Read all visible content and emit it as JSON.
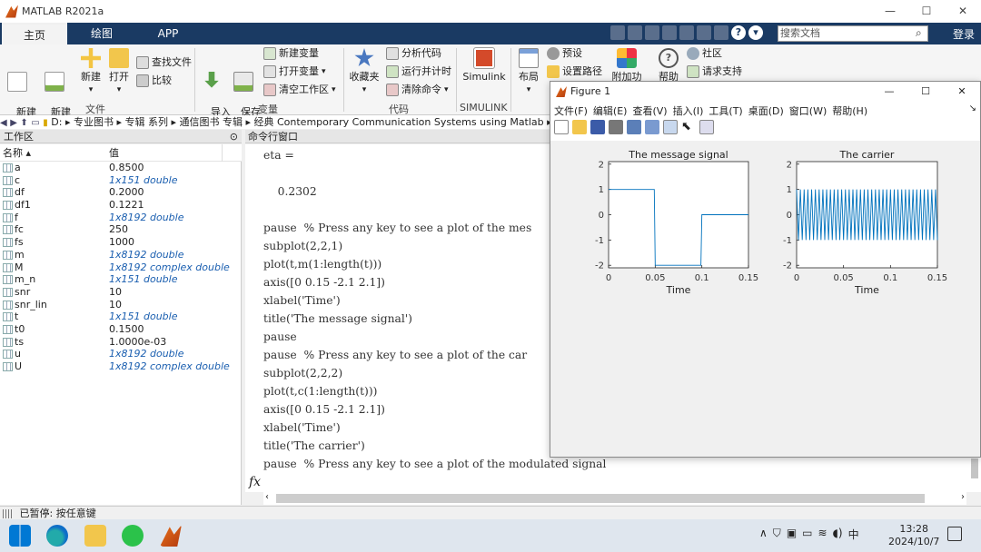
{
  "app": {
    "title": "MATLAB R2021a"
  },
  "window_controls": {
    "min": "—",
    "max": "☐",
    "close": "✕"
  },
  "ribbon_tabs": [
    "主页",
    "绘图",
    "APP"
  ],
  "search": {
    "placeholder": "搜索文档"
  },
  "login": "登录",
  "ribbon": {
    "file_group": {
      "label": "文件",
      "new_script": "新建\n脚本",
      "new_live_script": "新建\n实时脚本",
      "new": "新建",
      "open": "打开",
      "find_files": "查找文件",
      "compare": "比较"
    },
    "variable_group": {
      "label": "变量",
      "import": "导入\n数据",
      "save_ws": "保存\n工作区",
      "new_var": "新建变量",
      "open_var": "打开变量",
      "clear_ws": "清空工作区"
    },
    "code_group": {
      "label": "代码",
      "favorites": "收藏夹",
      "analyze": "分析代码",
      "run_time": "运行并计时",
      "clear_cmds": "清除命令"
    },
    "simulink_group": {
      "label": "SIMULINK",
      "simulink": "Simulink"
    },
    "env_group": {
      "layout": "布局",
      "prefs": "预设",
      "setpath": "设置路径",
      "addons": "附加功能"
    },
    "help_group": {
      "help": "帮助",
      "community": "社区",
      "support": "请求支持"
    }
  },
  "address": {
    "path": "D:  ▸  专业图书  ▸  专辑 系列  ▸  通信图书  专辑  ▸  经典 Contemporary Communication Systems using Matlab  ▸"
  },
  "workspace": {
    "title": "工作区",
    "col_name": "名称 ▴",
    "col_value": "值",
    "rows": [
      {
        "name": "a",
        "value": "0.8500",
        "italic": false
      },
      {
        "name": "c",
        "value": "1x151 double",
        "italic": true
      },
      {
        "name": "df",
        "value": "0.2000",
        "italic": false
      },
      {
        "name": "df1",
        "value": "0.1221",
        "italic": false
      },
      {
        "name": "f",
        "value": "1x8192 double",
        "italic": true
      },
      {
        "name": "fc",
        "value": "250",
        "italic": false
      },
      {
        "name": "fs",
        "value": "1000",
        "italic": false
      },
      {
        "name": "m",
        "value": "1x8192 double",
        "italic": true
      },
      {
        "name": "M",
        "value": "1x8192 complex double",
        "italic": true
      },
      {
        "name": "m_n",
        "value": "1x151 double",
        "italic": true
      },
      {
        "name": "snr",
        "value": "10",
        "italic": false
      },
      {
        "name": "snr_lin",
        "value": "10",
        "italic": false
      },
      {
        "name": "t",
        "value": "1x151 double",
        "italic": true
      },
      {
        "name": "t0",
        "value": "0.1500",
        "italic": false
      },
      {
        "name": "ts",
        "value": "1.0000e-03",
        "italic": false
      },
      {
        "name": "u",
        "value": "1x8192 double",
        "italic": true
      },
      {
        "name": "U",
        "value": "1x8192 complex double",
        "italic": true
      }
    ]
  },
  "command_window": {
    "title": "命令行窗口",
    "lines": [
      "eta =",
      "",
      "    0.2302",
      "",
      "pause  % Press any key to see a plot of the mes",
      "subplot(2,2,1)",
      "plot(t,m(1:length(t)))",
      "axis([0 0.15 -2.1 2.1])",
      "xlabel('Time')",
      "title('The message signal')",
      "pause",
      "pause  % Press any key to see a plot of the car",
      "subplot(2,2,2)",
      "plot(t,c(1:length(t)))",
      "axis([0 0.15 -2.1 2.1])",
      "xlabel('Time')",
      "title('The carrier')",
      "pause  % Press any key to see a plot of the modulated signal"
    ],
    "prompt": "fx"
  },
  "status": {
    "text": "已暂停: 按任意键"
  },
  "figure": {
    "title": "Figure 1",
    "menu": [
      "文件(F)",
      "编辑(E)",
      "查看(V)",
      "插入(I)",
      "工具(T)",
      "桌面(D)",
      "窗口(W)",
      "帮助(H)"
    ]
  },
  "chart_data": [
    {
      "type": "line",
      "title": "The message signal",
      "xlabel": "Time",
      "xlim": [
        0,
        0.15
      ],
      "ylim": [
        -2.1,
        2.1
      ],
      "xticks": [
        "0",
        "0.05",
        "0.1",
        "0.15"
      ],
      "yticks": [
        "-2",
        "-1",
        "0",
        "1",
        "2"
      ],
      "series": [
        {
          "x": [
            0,
            0.049,
            0.05,
            0.099,
            0.1,
            0.15
          ],
          "y": [
            1,
            1,
            -2,
            -2,
            0,
            0
          ],
          "color": "#0072bd"
        }
      ]
    },
    {
      "type": "line",
      "title": "The carrier",
      "xlabel": "Time",
      "xlim": [
        0,
        0.15
      ],
      "ylim": [
        -2.1,
        2.1
      ],
      "xticks": [
        "0",
        "0.05",
        "0.1",
        "0.15"
      ],
      "yticks": [
        "-2",
        "-1",
        "0",
        "1",
        "2"
      ],
      "series": [
        {
          "function": "cos(2*pi*250*t)",
          "fs": 1000,
          "t_start": 0,
          "t_end": 0.15,
          "color": "#0072bd"
        }
      ]
    }
  ],
  "taskbar": {
    "time": "13:28",
    "date": "2024/10/7",
    "ime": "中"
  }
}
